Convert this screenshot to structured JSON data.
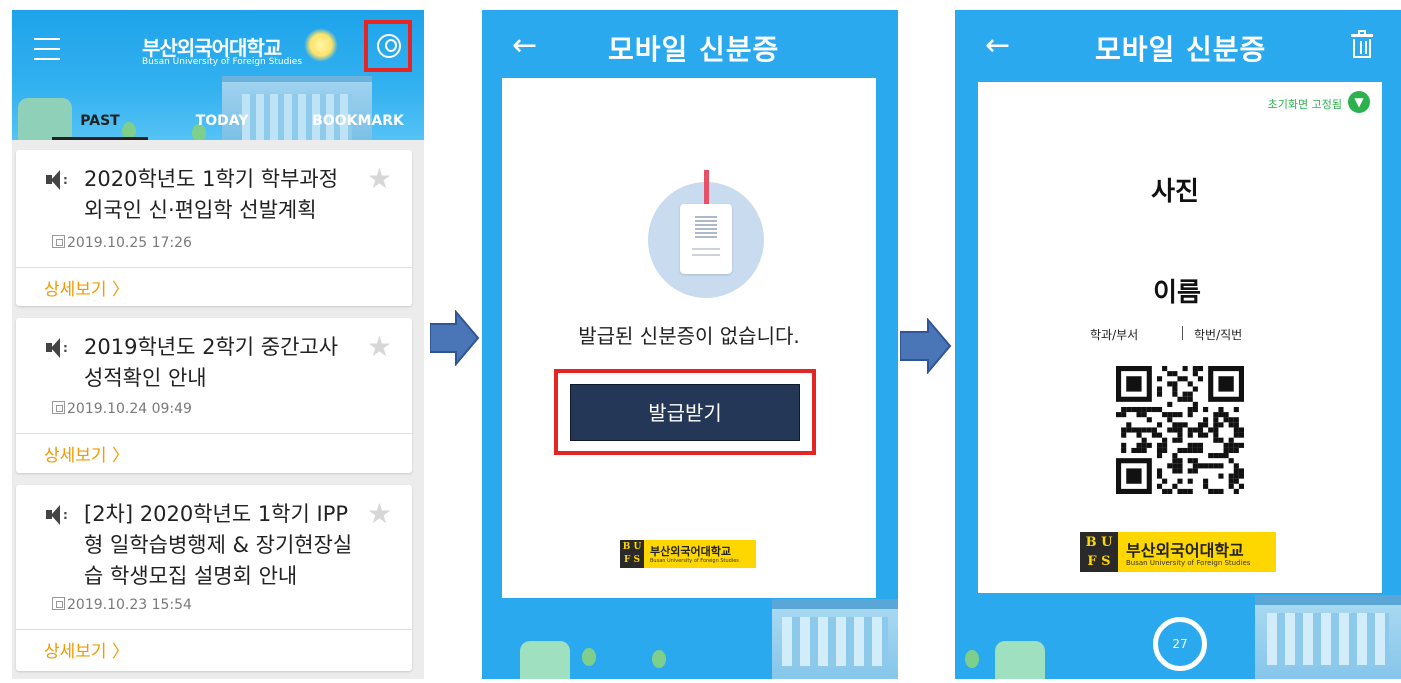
{
  "screen1": {
    "logo_ko": "부산외국어대학교",
    "logo_en": "Busan University of Foreign Studies",
    "tabs": [
      "PAST",
      "TODAY",
      "BOOKMARK"
    ],
    "notices": [
      {
        "title": "2020학년도 1학기 학부과정 외국인 신·편입학 선발계획",
        "date": "2019.10.25 17:26",
        "more": "상세보기 〉"
      },
      {
        "title": "2019학년도 2학기 중간고사 성적확인 안내",
        "date": "2019.10.24 09:49",
        "more": "상세보기 〉"
      },
      {
        "title": "[2차] 2020학년도 1학기 IPP형 일학습병행제 & 장기현장실습 학생모집 설명회 안내",
        "date": "2019.10.23 15:54",
        "more": "상세보기 〉"
      }
    ]
  },
  "screen2": {
    "back": "←",
    "title": "모바일 신분증",
    "empty_message": "발급된 신분증이 없습니다.",
    "issue_button": "발급받기",
    "logo_mark_top": "B U",
    "logo_mark_bottom": "F S",
    "logo_ko": "부산외국어대학교",
    "logo_en": "Busan University of Foreign Studies"
  },
  "screen3": {
    "back": "←",
    "title": "모바일 신분증",
    "pin_label": "초기화면 고정됨",
    "photo": "사진",
    "name": "이름",
    "dept": "학과/부서",
    "student_id": "학번/직번",
    "timer": "27",
    "logo_mark_top": "B U",
    "logo_mark_bottom": "F S",
    "logo_ko": "부산외국어대학교",
    "logo_en": "Busan University of Foreign Studies"
  },
  "colors": {
    "header_blue": "#1ea3ea",
    "highlight_red": "#e52424",
    "accent_orange": "#f09b00",
    "button_navy": "#253756",
    "arrow_blue": "#4a76b8",
    "pin_green": "#2bb24c"
  },
  "icons": {
    "menu": "hamburger-icon",
    "user": "user-icon",
    "speaker": "speaker-icon",
    "star": "star-icon",
    "calendar": "calendar-icon",
    "back": "back-arrow-icon",
    "trash": "trash-icon",
    "pin": "pin-icon",
    "flow": "right-arrow-icon"
  }
}
